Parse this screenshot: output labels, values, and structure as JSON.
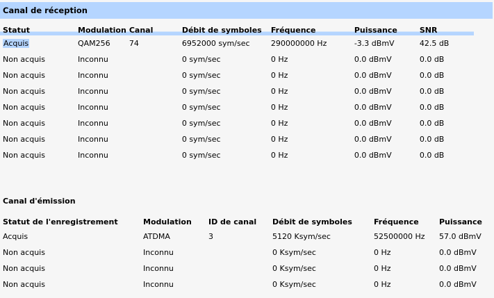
{
  "reception": {
    "title": "Canal de réception",
    "headers": [
      "Statut",
      "Modulation",
      "Canal",
      "Débit de symboles",
      "Fréquence",
      "Puissance",
      "SNR"
    ],
    "rows": [
      [
        "Acquis",
        "QAM256",
        "74",
        "6952000 sym/sec",
        "290000000 Hz",
        "-3.3 dBmV",
        "42.5 dB"
      ],
      [
        "Non acquis",
        "Inconnu",
        "",
        "0 sym/sec",
        "0 Hz",
        "0.0 dBmV",
        "0.0 dB"
      ],
      [
        "Non acquis",
        "Inconnu",
        "",
        "0 sym/sec",
        "0 Hz",
        "0.0 dBmV",
        "0.0 dB"
      ],
      [
        "Non acquis",
        "Inconnu",
        "",
        "0 sym/sec",
        "0 Hz",
        "0.0 dBmV",
        "0.0 dB"
      ],
      [
        "Non acquis",
        "Inconnu",
        "",
        "0 sym/sec",
        "0 Hz",
        "0.0 dBmV",
        "0.0 dB"
      ],
      [
        "Non acquis",
        "Inconnu",
        "",
        "0 sym/sec",
        "0 Hz",
        "0.0 dBmV",
        "0.0 dB"
      ],
      [
        "Non acquis",
        "Inconnu",
        "",
        "0 sym/sec",
        "0 Hz",
        "0.0 dBmV",
        "0.0 dB"
      ],
      [
        "Non acquis",
        "Inconnu",
        "",
        "0 sym/sec",
        "0 Hz",
        "0.0 dBmV",
        "0.0 dB"
      ]
    ]
  },
  "emission": {
    "title": "Canal d'émission",
    "headers": [
      "Statut de l'enregistrement",
      "Modulation",
      "ID de canal",
      "Débit de symboles",
      "Fréquence",
      "Puissance"
    ],
    "rows": [
      [
        "Acquis",
        "ATDMA",
        "3",
        "5120 Ksym/sec",
        "52500000 Hz",
        "57.0 dBmV"
      ],
      [
        "Non acquis",
        "Inconnu",
        "",
        "0 Ksym/sec",
        "0 Hz",
        "0.0 dBmV"
      ],
      [
        "Non acquis",
        "Inconnu",
        "",
        "0 Ksym/sec",
        "0 Hz",
        "0.0 dBmV"
      ],
      [
        "Non acquis",
        "Inconnu",
        "",
        "0 Ksym/sec",
        "0 Hz",
        "0.0 dBmV"
      ]
    ]
  },
  "colors": {
    "header_band": "#b5d5ff",
    "background": "#f6f6f6"
  }
}
